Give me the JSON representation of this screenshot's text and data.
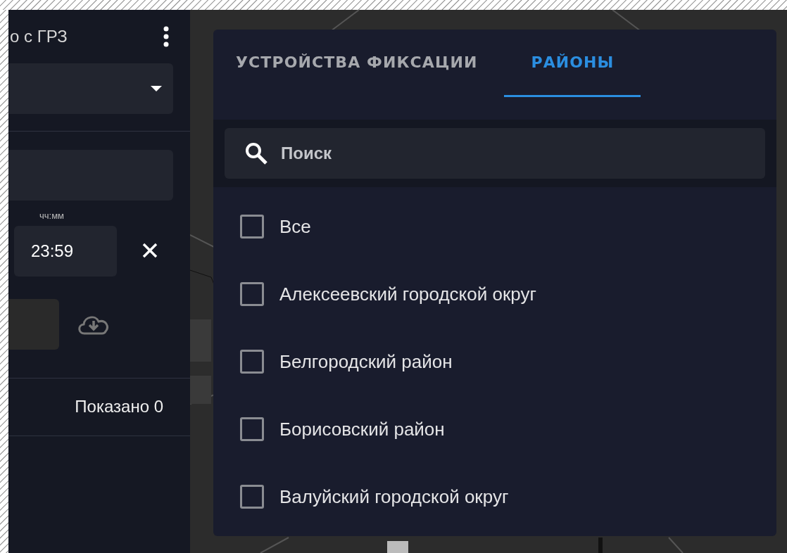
{
  "sidebar": {
    "title": "о с ГРЗ",
    "time_label": "чч:мм",
    "time_value": "23:59",
    "shown_count": "Показано 0"
  },
  "panel": {
    "tabs": [
      {
        "label": "УСТРОЙСТВА ФИКСАЦИИ",
        "selected": false
      },
      {
        "label": "РАЙОНЫ",
        "selected": true
      }
    ],
    "search": {
      "placeholder": "Поиск"
    },
    "items": [
      {
        "label": "Все",
        "checked": false
      },
      {
        "label": "Алексеевский городской округ",
        "checked": false
      },
      {
        "label": "Белгородский район",
        "checked": false
      },
      {
        "label": "Борисовский район",
        "checked": false
      },
      {
        "label": "Валуйский городской округ",
        "checked": false
      }
    ]
  }
}
